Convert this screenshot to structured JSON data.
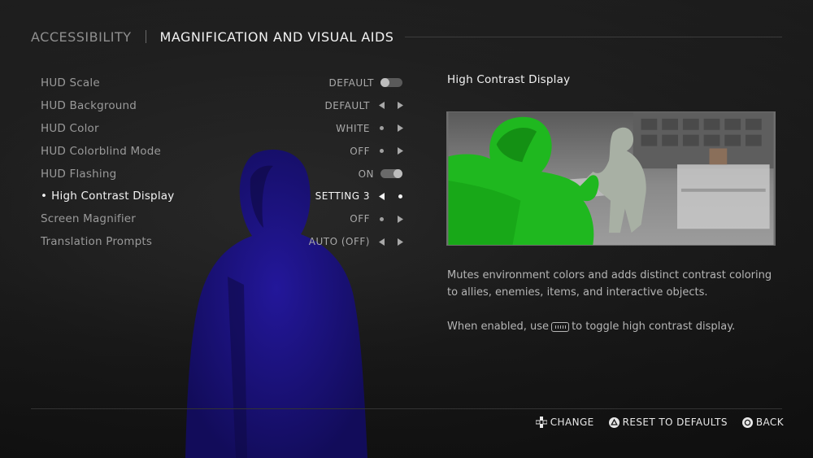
{
  "header": {
    "parent": "ACCESSIBILITY",
    "title": "MAGNIFICATION AND VISUAL AIDS"
  },
  "settings": [
    {
      "label": "HUD Scale",
      "value": "DEFAULT",
      "control": "toggle-off"
    },
    {
      "label": "HUD Background",
      "value": "DEFAULT",
      "control": "arrows"
    },
    {
      "label": "HUD Color",
      "value": "WHITE",
      "control": "dot-right"
    },
    {
      "label": "HUD Colorblind Mode",
      "value": "OFF",
      "control": "dot-right"
    },
    {
      "label": "HUD Flashing",
      "value": "ON",
      "control": "toggle-on"
    },
    {
      "label": "High Contrast Display",
      "value": "SETTING 3",
      "control": "left-dot",
      "selected": true
    },
    {
      "label": "Screen Magnifier",
      "value": "OFF",
      "control": "dot-right"
    },
    {
      "label": "Translation Prompts",
      "value": "AUTO (OFF)",
      "control": "arrows"
    }
  ],
  "detail": {
    "title": "High Contrast Display",
    "description": "Mutes environment colors and adds distinct contrast coloring to allies, enemies, items, and interactive objects.",
    "hint_before": "When enabled, use",
    "hint_icon": "touchpad-icon",
    "hint_after": "to toggle high contrast display."
  },
  "footer": {
    "change": "CHANGE",
    "reset": "RESET TO DEFAULTS",
    "back": "BACK"
  },
  "colors": {
    "ally_highlight": "#1fb81f",
    "character_tint": "#1a128a",
    "text_selected": "#f4f4f4",
    "text_dim": "#9a9a9a"
  }
}
